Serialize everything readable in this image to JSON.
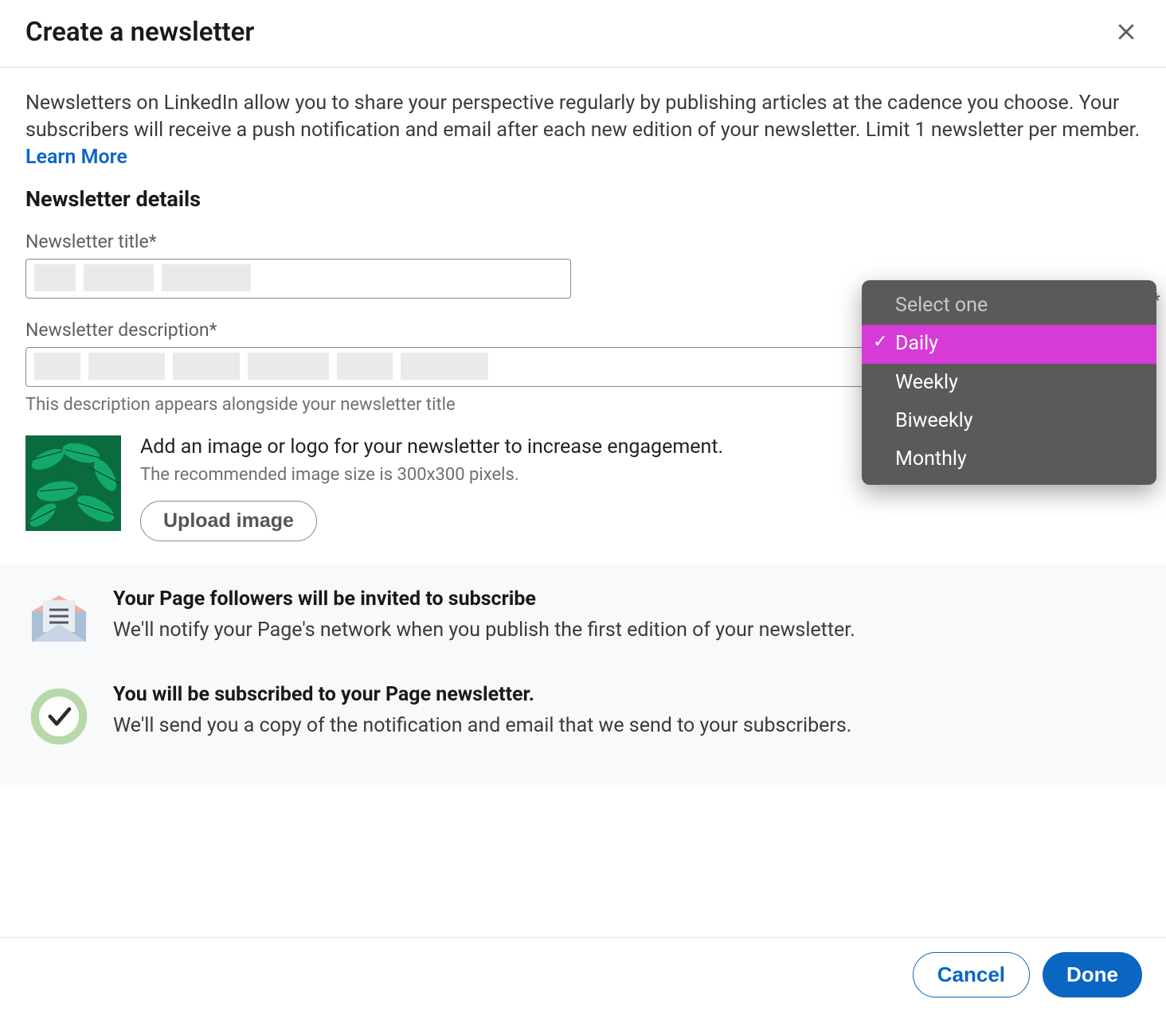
{
  "header": {
    "title": "Create a newsletter"
  },
  "intro": {
    "text": "Newsletters on LinkedIn allow you to share your perspective regularly by publishing articles at the cadence you choose. Your subscribers will receive a push notification and email after each new edition of your newsletter. Limit 1 newsletter per member. ",
    "learn_more": "Learn More"
  },
  "details": {
    "section_title": "Newsletter details",
    "title_label": "Newsletter title*",
    "description_label": "Newsletter description*",
    "description_helper": "This description appears alongside your newsletter title"
  },
  "cadence": {
    "required_marker": "*",
    "placeholder": "Select one",
    "options": [
      "Daily",
      "Weekly",
      "Biweekly",
      "Monthly"
    ],
    "selected": "Daily"
  },
  "image": {
    "headline": "Add an image or logo for your newsletter to increase engagement.",
    "recommended": "The recommended image size is 300x300 pixels.",
    "upload_label": "Upload image"
  },
  "notices": [
    {
      "title": "Your Page followers will be invited to subscribe",
      "body": "We'll notify your Page's network when you publish the first edition of your newsletter."
    },
    {
      "title": "You will be subscribed to your Page newsletter.",
      "body": "We'll send you a copy of the notification and email that we send to your subscribers."
    }
  ],
  "footer": {
    "cancel": "Cancel",
    "done": "Done"
  }
}
